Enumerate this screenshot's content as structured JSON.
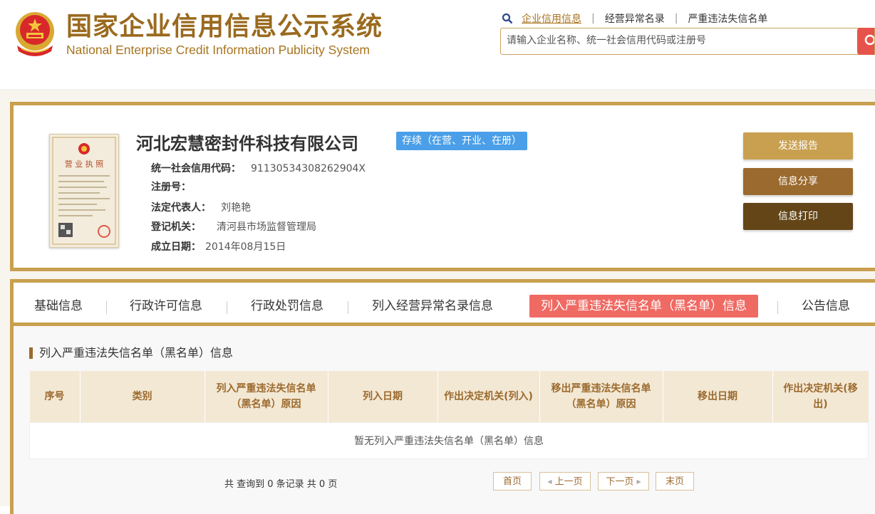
{
  "header": {
    "logo_cn": "国家企业信用信息公示系统",
    "logo_en": "National Enterprise Credit Information Publicity System",
    "nav": [
      {
        "label": "企业信用信息",
        "active": true
      },
      {
        "label": "经营异常名录",
        "active": false
      },
      {
        "label": "严重违法失信名单",
        "active": false
      }
    ],
    "nav_sep": "|",
    "search_placeholder": "请输入企业名称、统一社会信用代码或注册号"
  },
  "company": {
    "name": "河北宏慧密封件科技有限公司",
    "status": "存续（在营、开业、在册）",
    "fields": [
      {
        "label": "统一社会信用代码：",
        "value": "91130534308262904X"
      },
      {
        "label": "注册号：",
        "value": ""
      },
      {
        "label": "法定代表人：",
        "value": "刘艳艳"
      },
      {
        "label": "登记机关：",
        "value": "清河县市场监督管理局"
      },
      {
        "label": "成立日期：",
        "value": "2014年08月15日"
      }
    ],
    "license_title": "营 业 执 照"
  },
  "actions": {
    "send_report": "发送报告",
    "share": "信息分享",
    "print": "信息打印"
  },
  "tabs": [
    {
      "label": "基础信息",
      "active": false
    },
    {
      "label": "行政许可信息",
      "active": false
    },
    {
      "label": "行政处罚信息",
      "active": false
    },
    {
      "label": "列入经营异常名录信息",
      "active": false
    },
    {
      "label": "列入严重违法失信名单（黑名单）信息",
      "active": true
    },
    {
      "label": "公告信息",
      "active": false
    }
  ],
  "section": {
    "title": "列入严重违法失信名单（黑名单）信息",
    "columns": [
      "序号",
      "类别",
      "列入严重违法失信名单（黑名单）原因",
      "列入日期",
      "作出决定机关(列入)",
      "移出严重违法失信名单（黑名单）原因",
      "移出日期",
      "作出决定机关(移出)"
    ],
    "empty_text": "暂无列入严重违法失信名单（黑名单）信息"
  },
  "pager": {
    "summary": "共 查询到 0 条记录 共 0 页",
    "first": "首页",
    "prev": "上一页",
    "next": "下一页",
    "last": "末页"
  },
  "colors": {
    "brand_gold": "#c9a04f",
    "brand_brown": "#9b6a2e",
    "brand_dark": "#634517",
    "active_tab": "#ef6a63",
    "status_blue": "#4a9fe8"
  }
}
